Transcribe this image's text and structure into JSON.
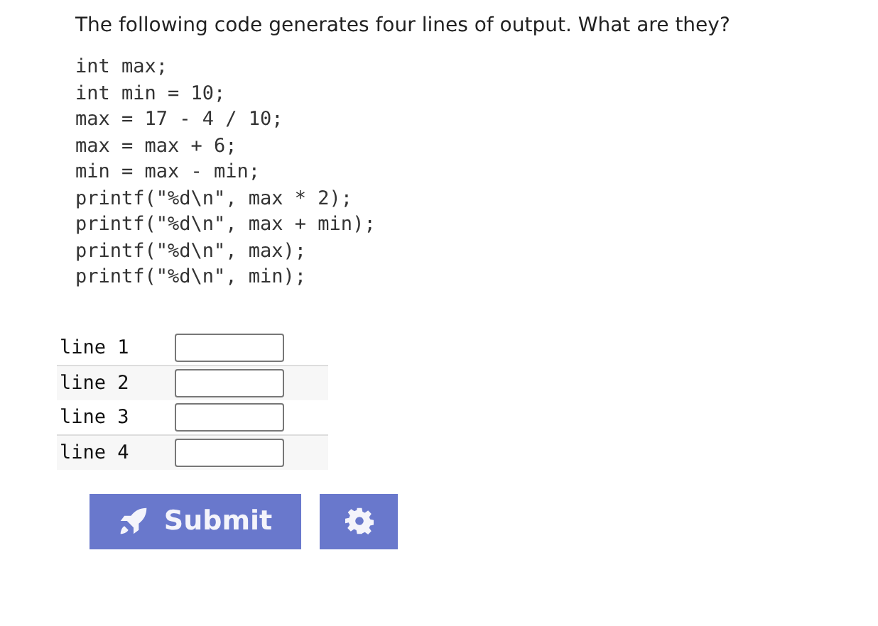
{
  "question": "The following code generates four lines of output. What are they?",
  "code": [
    "int max;",
    "int min = 10;",
    "max = 17 - 4 / 10;",
    "max = max + 6;",
    "min = max - min;",
    "printf(\"%d\\n\", max * 2);",
    "printf(\"%d\\n\", max + min);",
    "printf(\"%d\\n\", max);",
    "printf(\"%d\\n\", min);"
  ],
  "answers": [
    {
      "label": "line 1"
    },
    {
      "label": "line 2"
    },
    {
      "label": "line 3"
    },
    {
      "label": "line 4"
    }
  ],
  "submit": {
    "label": "Submit"
  }
}
